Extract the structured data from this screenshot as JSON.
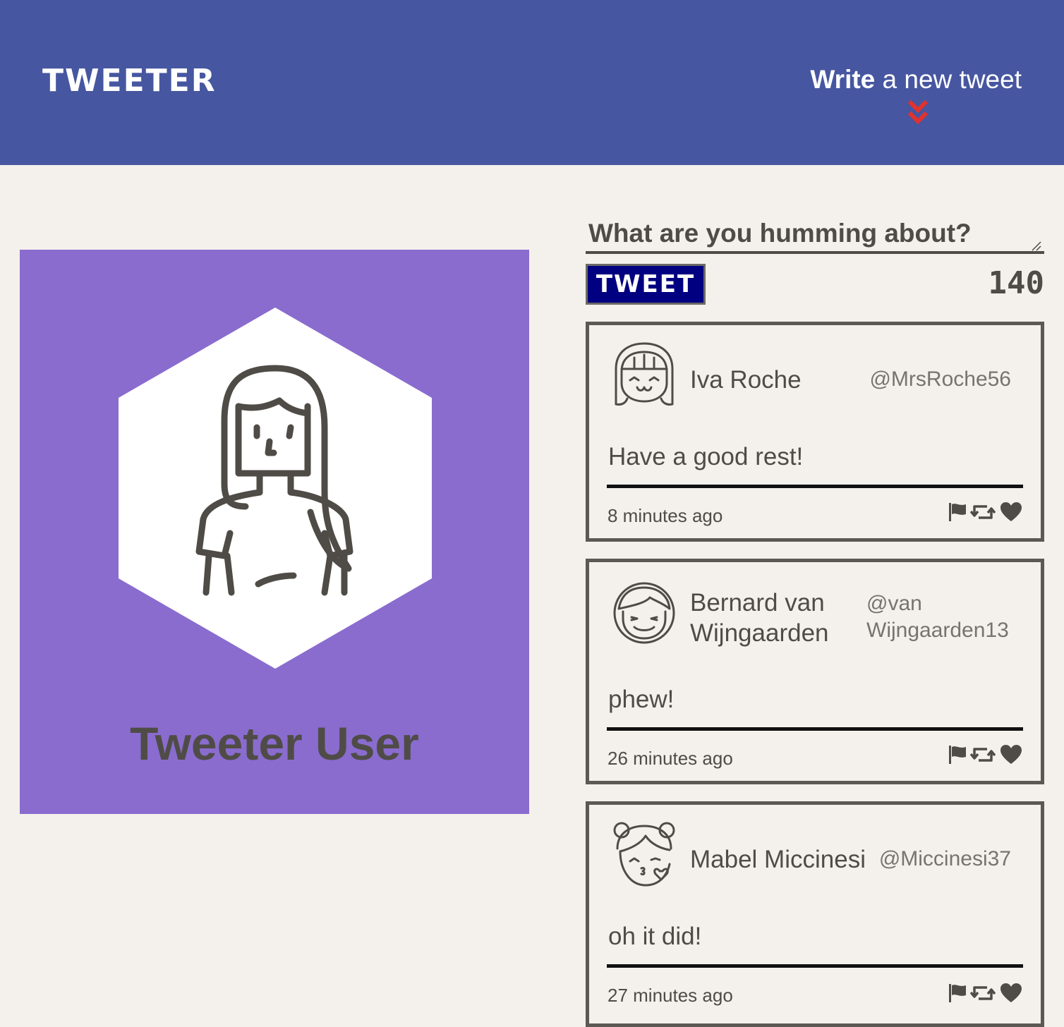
{
  "nav": {
    "brand": "TWEETER",
    "write_bold": "Write",
    "write_rest": " a new tweet",
    "chevron_icon": "double-chevron-down-icon",
    "accent": "#e0322f",
    "background": "#4656a0"
  },
  "profile": {
    "name": "Tweeter User",
    "avatar_icon": "woman-avatar-icon",
    "background": "#8a6ccf"
  },
  "compose": {
    "placeholder": "What are you humming about?",
    "button_label": "TWEET",
    "counter": "140",
    "button_color": "#000080"
  },
  "tweets": [
    {
      "name": "Iva Roche",
      "handle": "@MrsRoche56",
      "text": "Have a good rest!",
      "time": "8 minutes ago",
      "avatar_icon": "girl-bangs-avatar-icon"
    },
    {
      "name": "Bernard van Wijngaarden",
      "handle": "@van Wijngaarden13",
      "text": "phew!",
      "time": "26 minutes ago",
      "avatar_icon": "boy-avatar-icon"
    },
    {
      "name": "Mabel Miccinesi",
      "handle": "@Miccinesi37",
      "text": "oh it did!",
      "time": "27 minutes ago",
      "avatar_icon": "girl-buns-kiss-avatar-icon"
    }
  ],
  "action_icons": [
    "flag-icon",
    "retweet-icon",
    "heart-icon"
  ]
}
